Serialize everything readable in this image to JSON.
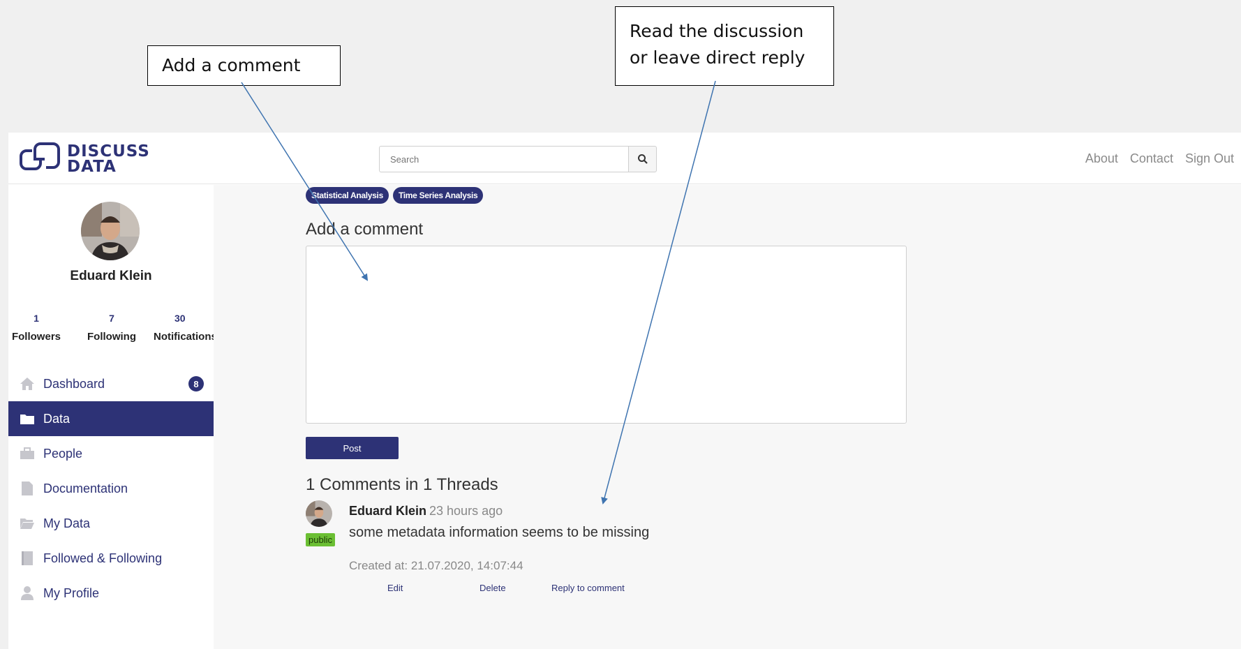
{
  "callouts": {
    "add_comment": "Add a comment",
    "discussion": "Read the discussion or leave direct reply"
  },
  "header": {
    "logo_line1": "DISCUSS",
    "logo_line2": "DATA",
    "search_placeholder": "Search",
    "nav": [
      "About",
      "Contact",
      "Sign Out"
    ]
  },
  "profile": {
    "name": "Eduard Klein",
    "stats": [
      {
        "value": "1",
        "label": "Followers"
      },
      {
        "value": "7",
        "label": "Following"
      },
      {
        "value": "30",
        "label": "Notifications"
      }
    ]
  },
  "menu": [
    {
      "label": "Dashboard",
      "icon": "home-icon",
      "badge": "8",
      "active": false
    },
    {
      "label": "Data",
      "icon": "folder-icon",
      "active": true
    },
    {
      "label": "People",
      "icon": "briefcase-icon",
      "active": false
    },
    {
      "label": "Documentation",
      "icon": "document-icon",
      "active": false
    },
    {
      "label": "My Data",
      "icon": "open-folder-icon",
      "active": false
    },
    {
      "label": "Followed & Following",
      "icon": "book-icon",
      "active": false
    },
    {
      "label": "My Profile",
      "icon": "user-icon",
      "active": false
    }
  ],
  "tags": [
    "Statistical Analysis",
    "Time Series Analysis"
  ],
  "comment_form": {
    "title": "Add a comment",
    "post_label": "Post"
  },
  "threads": {
    "title": "1 Comments in 1 Threads",
    "comment": {
      "author": "Eduard Klein",
      "time": "23 hours ago",
      "visibility": "public",
      "text": "some metadata information seems to be missing",
      "created": "Created at: 21.07.2020, 14:07:44",
      "actions": [
        "Edit",
        "Delete",
        "Reply to comment"
      ]
    }
  },
  "colors": {
    "brand": "#2d3276",
    "public_badge": "#6bbf33"
  }
}
